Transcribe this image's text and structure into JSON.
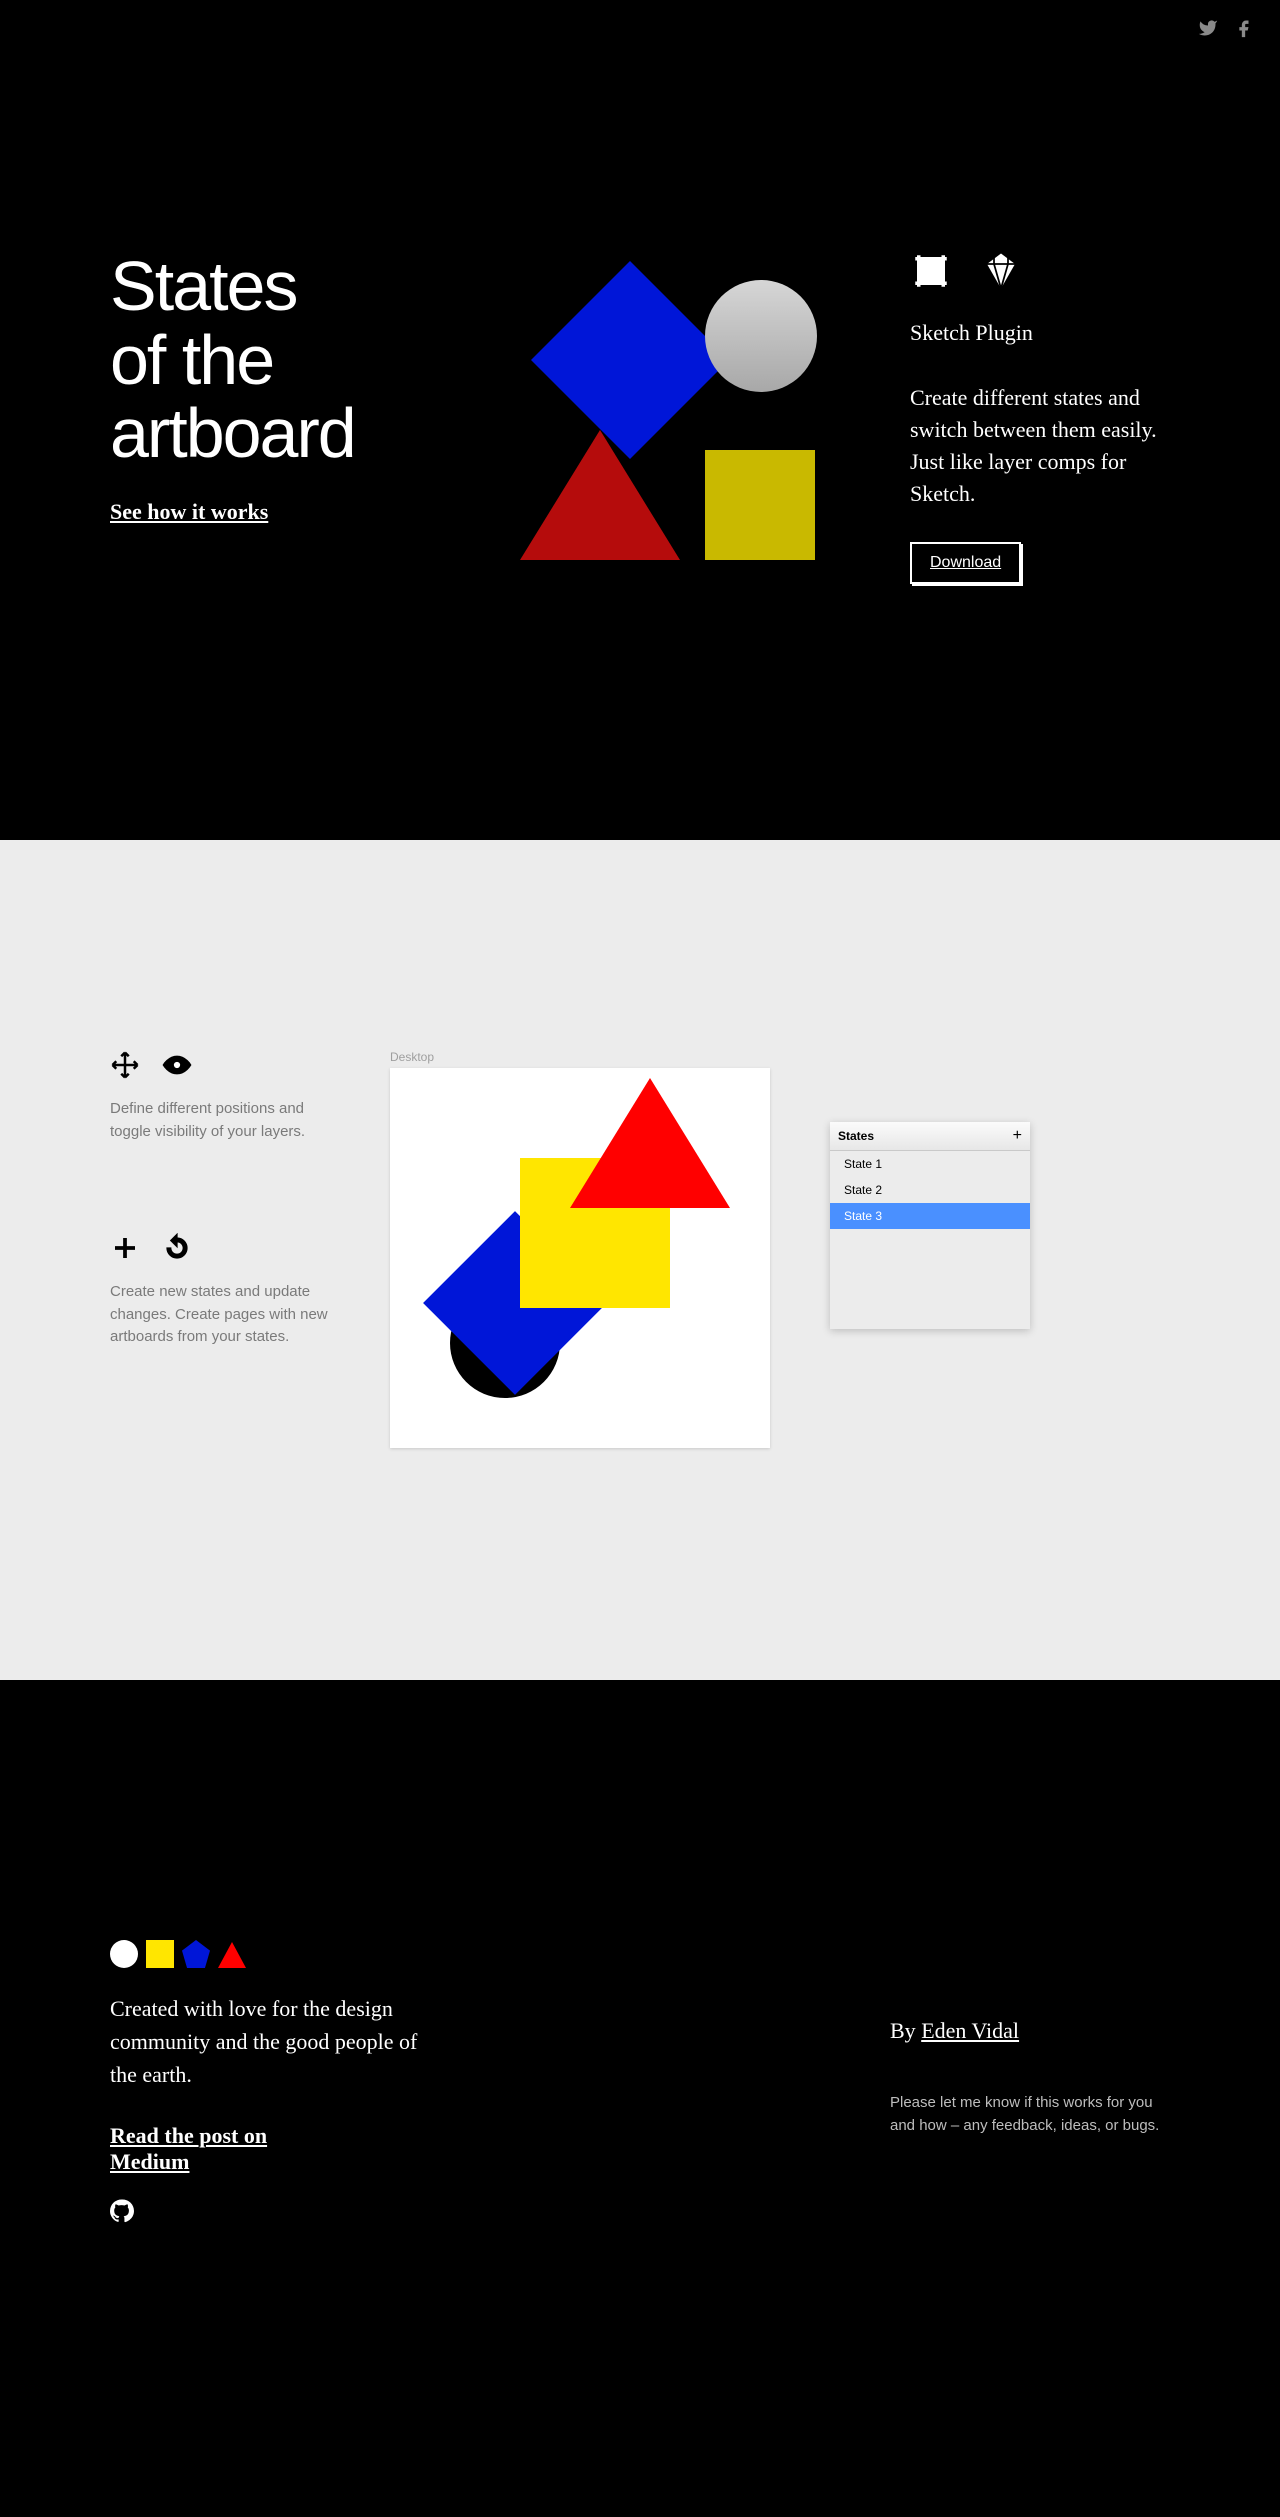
{
  "hero": {
    "title_line1": "States",
    "title_line2": "of the",
    "title_line3": "artboard",
    "see_link": "See how it works",
    "subhead": "Sketch Plugin",
    "description": "Create different states and switch between them easily. Just like layer comps for Sketch.",
    "download_label": "Download"
  },
  "demo": {
    "artboard_label": "Desktop",
    "feature1": "Define different positions and toggle visibility of your layers.",
    "feature2": "Create new states and update changes. Create pages with new artboards from your states.",
    "panel": {
      "title": "States",
      "rows": [
        "State 1",
        "State 2",
        "State 3"
      ],
      "selected_index": 2
    }
  },
  "footer": {
    "paragraph": "Created with love for the design community and the good people of the earth.",
    "medium_link_line1": "Read the post on",
    "medium_link_line2": "Medium",
    "by_prefix": "By ",
    "author": "Eden Vidal",
    "note": "Please let me know if this works for you and how – any feedback, ideas, or bugs."
  },
  "colors": {
    "blue": "#0016d8",
    "red": "#ff0000",
    "darkred": "#b50c0c",
    "yellow": "#ffe600",
    "mustard": "#c9b900",
    "black": "#000000",
    "gray_bg": "#ececec"
  }
}
